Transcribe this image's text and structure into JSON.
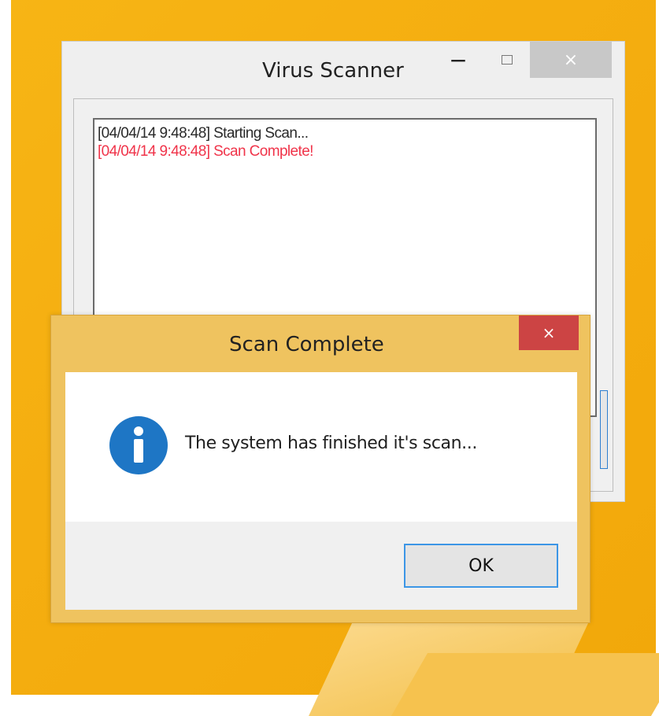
{
  "main_window": {
    "title": "Virus Scanner",
    "minimize_label": "−",
    "close_label": "×",
    "log_lines": [
      {
        "text": "[04/04/14 9:48:48] Starting Scan...",
        "color": "#2a2a2a"
      },
      {
        "text": "[04/04/14 9:48:48] Scan Complete!",
        "color": "#f0344a"
      }
    ]
  },
  "dialog": {
    "title": "Scan Complete",
    "close_label": "×",
    "icon": "info-icon",
    "message": "The system has finished it's scan...",
    "ok_label": "OK"
  },
  "colors": {
    "desktop": "#f5ae10",
    "dialog_frame": "#efc35f",
    "dialog_close": "#cc4444",
    "info_icon": "#1e76c5",
    "focus_border": "#3c96e6"
  }
}
